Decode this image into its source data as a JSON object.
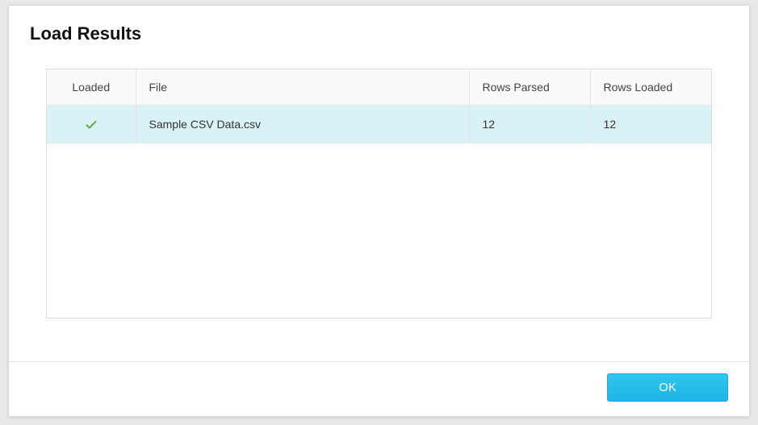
{
  "dialog": {
    "title": "Load Results",
    "ok_label": "OK"
  },
  "table": {
    "headers": {
      "loaded": "Loaded",
      "file": "File",
      "rows_parsed": "Rows Parsed",
      "rows_loaded": "Rows Loaded"
    },
    "rows": [
      {
        "status": "success",
        "file": "Sample CSV Data.csv",
        "rows_parsed": "12",
        "rows_loaded": "12"
      }
    ]
  }
}
